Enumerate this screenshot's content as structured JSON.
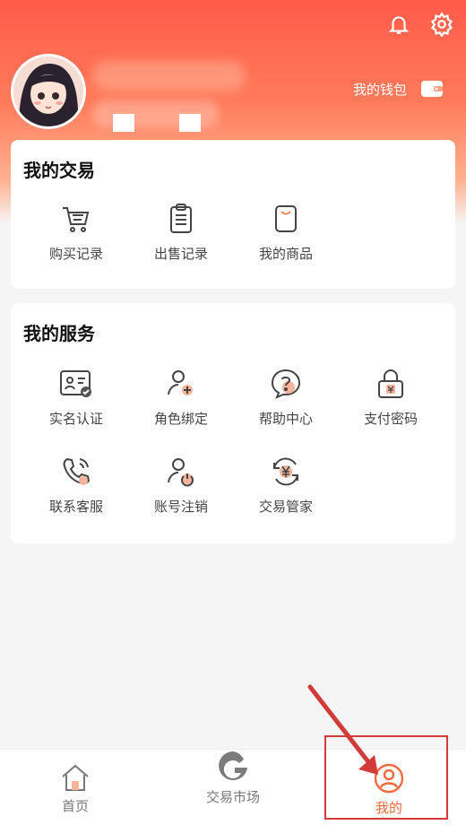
{
  "header": {
    "wallet_label": "我的钱包",
    "icons": {
      "notification": "bell-icon",
      "settings": "gear-icon",
      "wallet": "wallet-icon"
    }
  },
  "my_trade": {
    "title": "我的交易",
    "items": [
      {
        "label": "购买记录",
        "icon": "cart-icon"
      },
      {
        "label": "出售记录",
        "icon": "clipboard-icon"
      },
      {
        "label": "我的商品",
        "icon": "bag-icon"
      }
    ]
  },
  "my_service": {
    "title": "我的服务",
    "items": [
      {
        "label": "实名认证",
        "icon": "id-card-icon"
      },
      {
        "label": "角色绑定",
        "icon": "user-link-icon"
      },
      {
        "label": "帮助中心",
        "icon": "help-icon"
      },
      {
        "label": "支付密码",
        "icon": "lock-icon"
      },
      {
        "label": "联系客服",
        "icon": "phone-icon"
      },
      {
        "label": "账号注销",
        "icon": "user-power-icon"
      },
      {
        "label": "交易管家",
        "icon": "yen-cycle-icon"
      }
    ]
  },
  "bottom_nav": {
    "items": [
      {
        "label": "首页",
        "icon": "home-icon"
      },
      {
        "label": "交易市场",
        "icon": "market-logo-icon"
      },
      {
        "label": "我的",
        "icon": "user-circle-icon",
        "active": true
      }
    ]
  },
  "colors": {
    "accent": "#f26a3d",
    "header_top": "#ff5b4a",
    "annotation": "#d33b3b"
  }
}
